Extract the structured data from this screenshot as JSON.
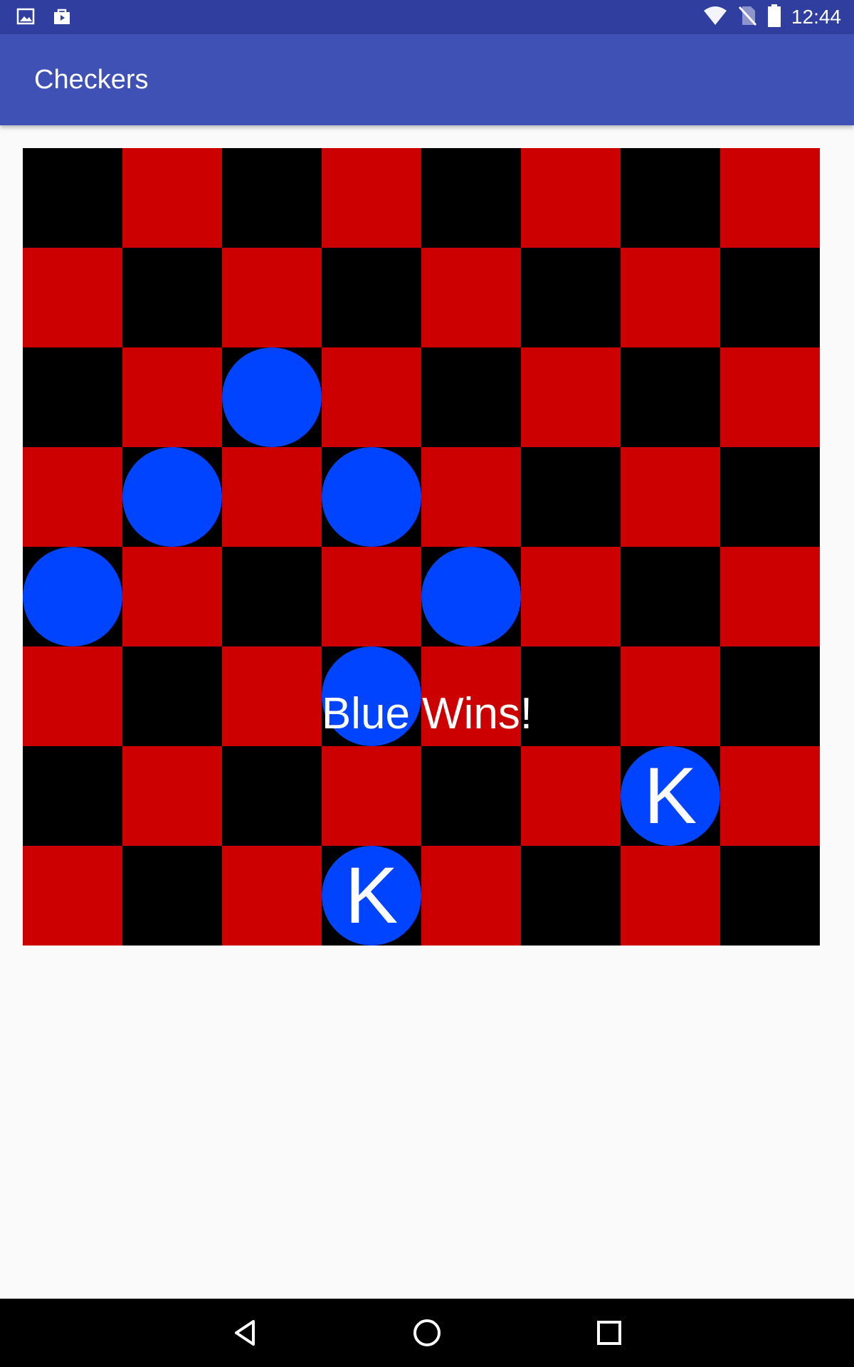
{
  "status_bar": {
    "time": "12:44",
    "left_icons": [
      "image-notification-icon",
      "store-notification-icon"
    ],
    "right_icons": [
      "wifi-icon",
      "no-sim-icon",
      "battery-icon"
    ]
  },
  "app_bar": {
    "title": "Checkers"
  },
  "colors": {
    "status_bar": "#303f9f",
    "app_bar": "#3f51b5",
    "dark_square": "#000000",
    "light_square": "#cc0000",
    "blue_piece": "#0044ff",
    "background": "#fafafa"
  },
  "board": {
    "size": 8,
    "first_square": "black",
    "pieces": [
      {
        "row": 2,
        "col": 2,
        "color": "blue",
        "king": false,
        "label": ""
      },
      {
        "row": 3,
        "col": 1,
        "color": "blue",
        "king": false,
        "label": ""
      },
      {
        "row": 3,
        "col": 3,
        "color": "blue",
        "king": false,
        "label": ""
      },
      {
        "row": 4,
        "col": 0,
        "color": "blue",
        "king": false,
        "label": ""
      },
      {
        "row": 4,
        "col": 4,
        "color": "blue",
        "king": false,
        "label": ""
      },
      {
        "row": 5,
        "col": 3,
        "color": "blue",
        "king": false,
        "label": ""
      },
      {
        "row": 6,
        "col": 6,
        "color": "blue",
        "king": true,
        "label": "K"
      },
      {
        "row": 7,
        "col": 3,
        "color": "blue",
        "king": true,
        "label": "K"
      }
    ]
  },
  "result_message": "Blue Wins!",
  "nav_bar": {
    "buttons": [
      "back-icon",
      "home-icon",
      "recents-icon"
    ]
  }
}
